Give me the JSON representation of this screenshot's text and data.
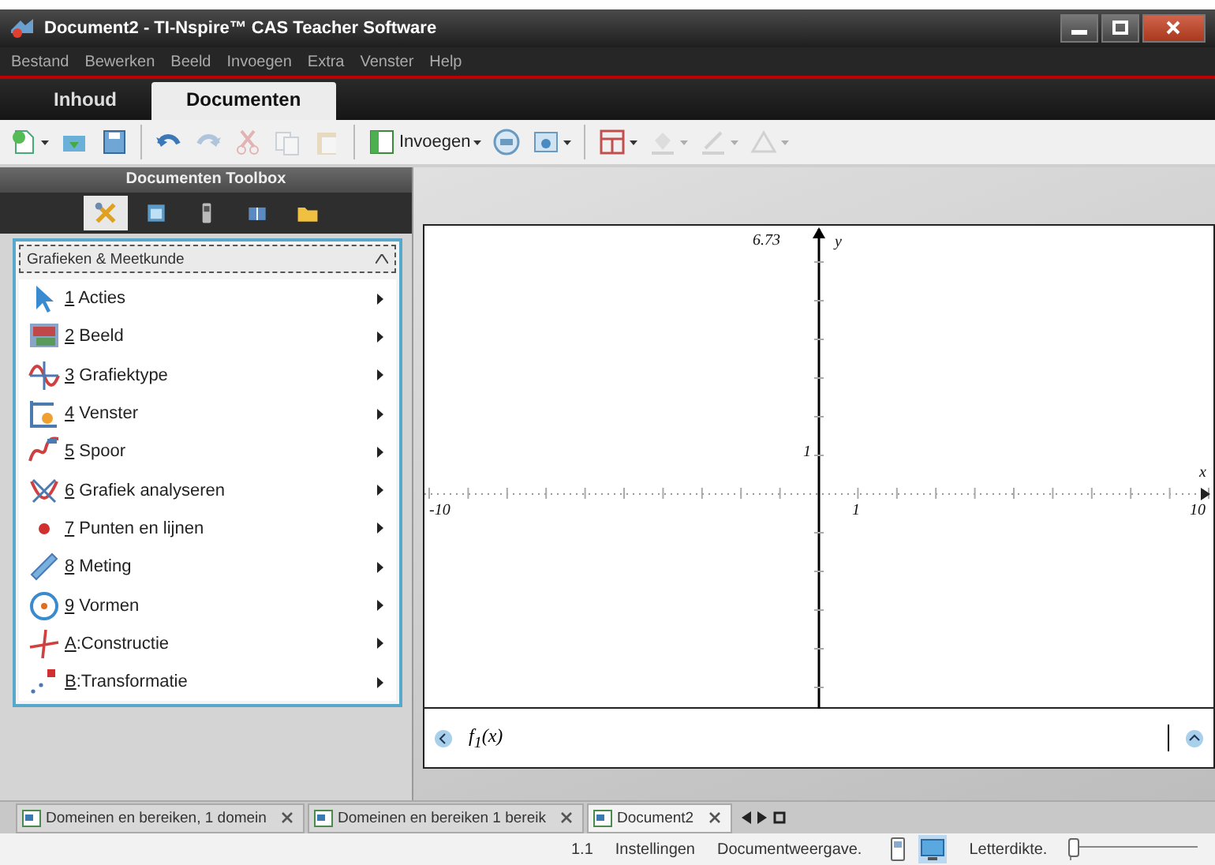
{
  "window": {
    "title": "Document2 - TI-Nspire™ CAS Teacher Software"
  },
  "menu": [
    "Bestand",
    "Bewerken",
    "Beeld",
    "Invoegen",
    "Extra",
    "Venster",
    "Help"
  ],
  "workspace_tabs": [
    {
      "label": "Inhoud",
      "selected": false
    },
    {
      "label": "Documenten",
      "selected": true
    }
  ],
  "toolbar": [
    {
      "kind": "new",
      "disabled": false,
      "caret": true
    },
    {
      "kind": "open",
      "disabled": false,
      "caret": false
    },
    {
      "kind": "save",
      "disabled": false,
      "caret": false
    },
    {
      "kind": "separator"
    },
    {
      "kind": "undo",
      "disabled": false,
      "caret": false
    },
    {
      "kind": "redo",
      "disabled": true,
      "caret": false
    },
    {
      "kind": "cut",
      "disabled": true,
      "caret": false
    },
    {
      "kind": "copy",
      "disabled": true,
      "caret": false
    },
    {
      "kind": "paste",
      "disabled": true,
      "caret": false
    },
    {
      "kind": "separator"
    },
    {
      "kind": "insert",
      "label": "Invoegen",
      "disabled": false,
      "caret": true
    },
    {
      "kind": "variables",
      "disabled": false,
      "caret": false
    },
    {
      "kind": "image",
      "disabled": false,
      "caret": true
    },
    {
      "kind": "separator"
    },
    {
      "kind": "layout",
      "disabled": false,
      "caret": true
    },
    {
      "kind": "fill",
      "disabled": true,
      "caret": true
    },
    {
      "kind": "line",
      "disabled": true,
      "caret": true
    },
    {
      "kind": "shape",
      "disabled": true,
      "caret": true
    }
  ],
  "toolbox": {
    "title": "Documenten Toolbox",
    "tabs": [
      {
        "kind": "tools",
        "selected": true
      },
      {
        "kind": "browser",
        "selected": false
      },
      {
        "kind": "device",
        "selected": false
      },
      {
        "kind": "library",
        "selected": false
      },
      {
        "kind": "folder",
        "selected": false
      }
    ],
    "section": "Grafieken & Meetkunde",
    "items": [
      {
        "kind": "pointer",
        "text": "1 Acties"
      },
      {
        "kind": "view",
        "text": "2 Beeld"
      },
      {
        "kind": "graphtype",
        "text": "3 Grafiektype"
      },
      {
        "kind": "window",
        "text": "4 Venster"
      },
      {
        "kind": "trace",
        "text": "5 Spoor"
      },
      {
        "kind": "analyze",
        "text": "6 Grafiek analyseren"
      },
      {
        "kind": "point",
        "text": "7 Punten en lijnen"
      },
      {
        "kind": "measure",
        "text": "8 Meting"
      },
      {
        "kind": "shapes",
        "text": "9 Vormen"
      },
      {
        "kind": "construct",
        "text": "A:Constructie"
      },
      {
        "kind": "transform",
        "text": "B:Transformatie"
      }
    ]
  },
  "graph": {
    "y_max": "6.73",
    "y_label": "y",
    "y_tick": "1",
    "x_min": "-10",
    "x_tick": "1",
    "x_max": "10",
    "x_label": "x",
    "entry": "f$_{1}$(x)"
  },
  "document_tabs": [
    {
      "label": "Domeinen en bereiken, 1 domein",
      "selected": false
    },
    {
      "label": "Domeinen en bereiken 1 bereik",
      "selected": false
    },
    {
      "label": "Document2",
      "selected": true
    }
  ],
  "status_bar": {
    "page": "1.1",
    "settings": "Instellingen",
    "view_label": "Documentweergave.",
    "view_modes": [
      {
        "kind": "handheld",
        "selected": false
      },
      {
        "kind": "computer",
        "selected": true
      }
    ],
    "thickness_label": "Letterdikte.",
    "slider": {
      "level": 0.02
    }
  }
}
